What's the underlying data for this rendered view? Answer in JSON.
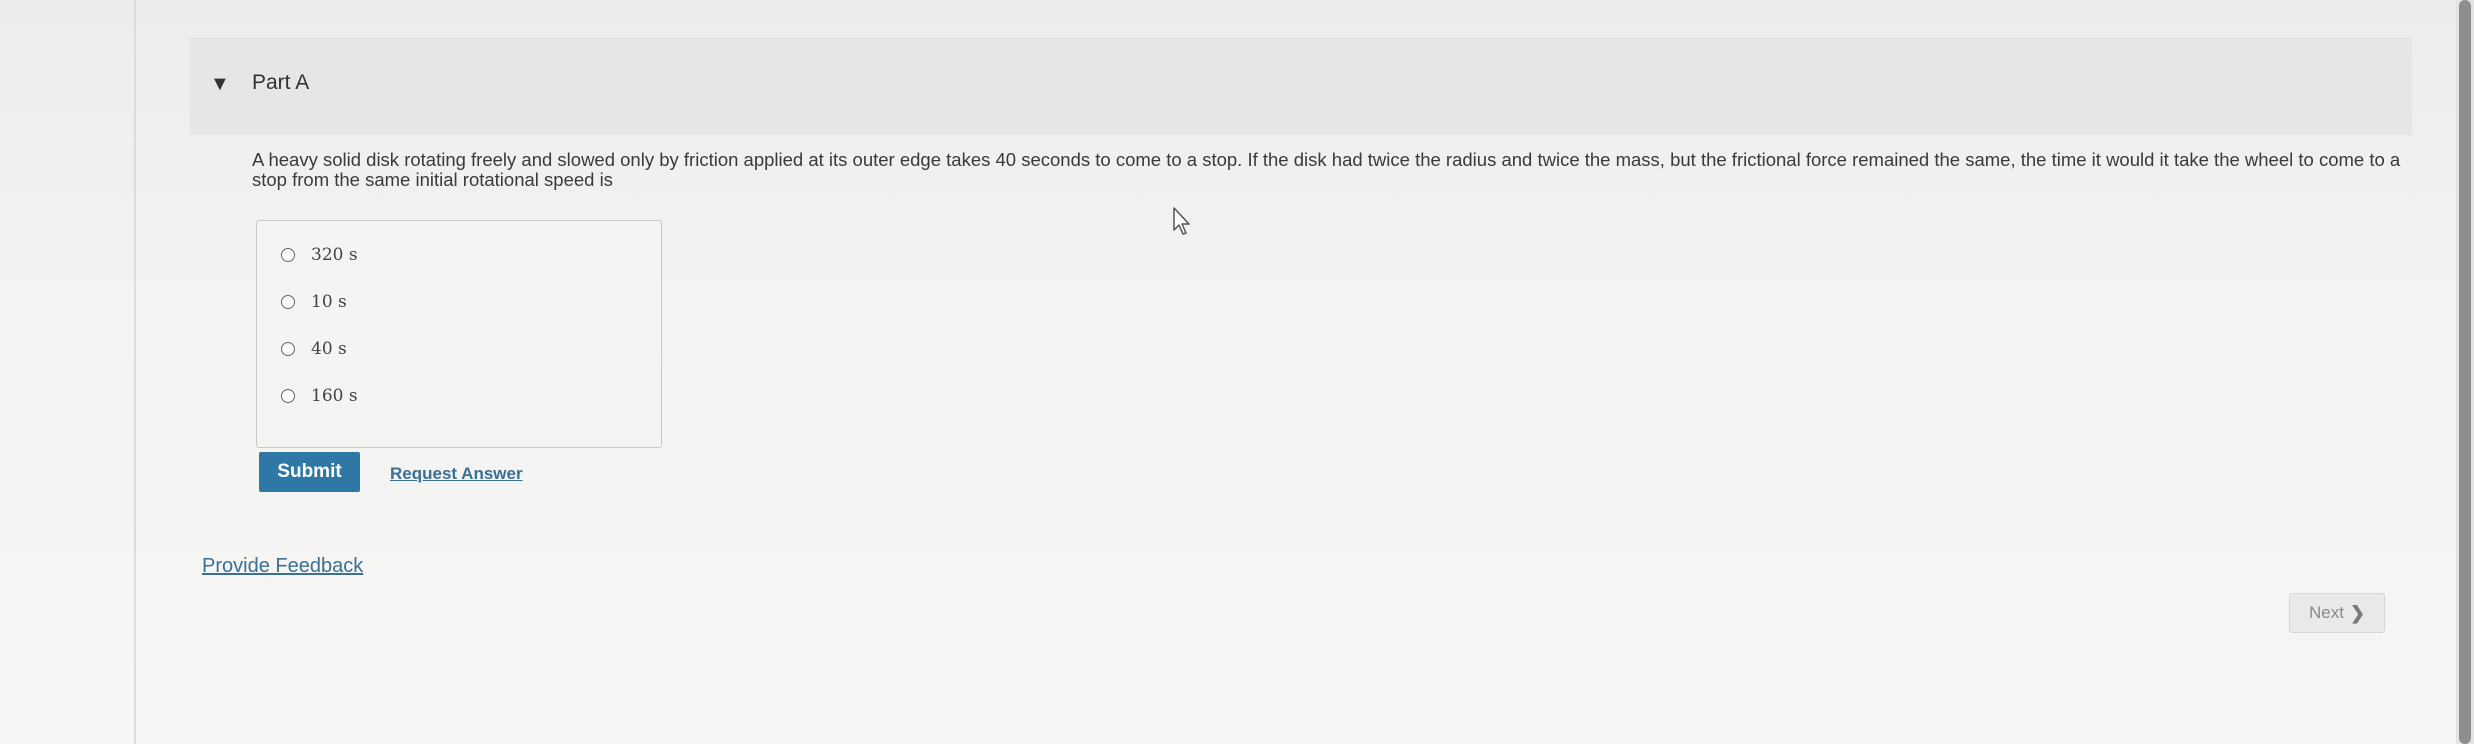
{
  "part": {
    "title": "Part A"
  },
  "question": {
    "text": "A heavy solid disk rotating freely and slowed only by friction applied at its outer edge takes 40 seconds to come to a stop. If the disk had twice the radius and twice the mass, but the frictional force remained the same, the time it would it take the wheel to come to a stop from the same initial rotational speed is"
  },
  "choices": [
    {
      "label": "320 s"
    },
    {
      "label": "10 s"
    },
    {
      "label": "40 s"
    },
    {
      "label": "160 s"
    }
  ],
  "actions": {
    "submit_label": "Submit",
    "request_answer_label": "Request Answer",
    "feedback_label": "Provide Feedback",
    "next_label": "Next"
  },
  "icons": {
    "caret": "caret-down-icon",
    "next": "chevron-right-icon",
    "cursor": "mouse-pointer-icon"
  },
  "colors": {
    "submit_bg": "#2f78a6",
    "link": "#3b6f94"
  }
}
